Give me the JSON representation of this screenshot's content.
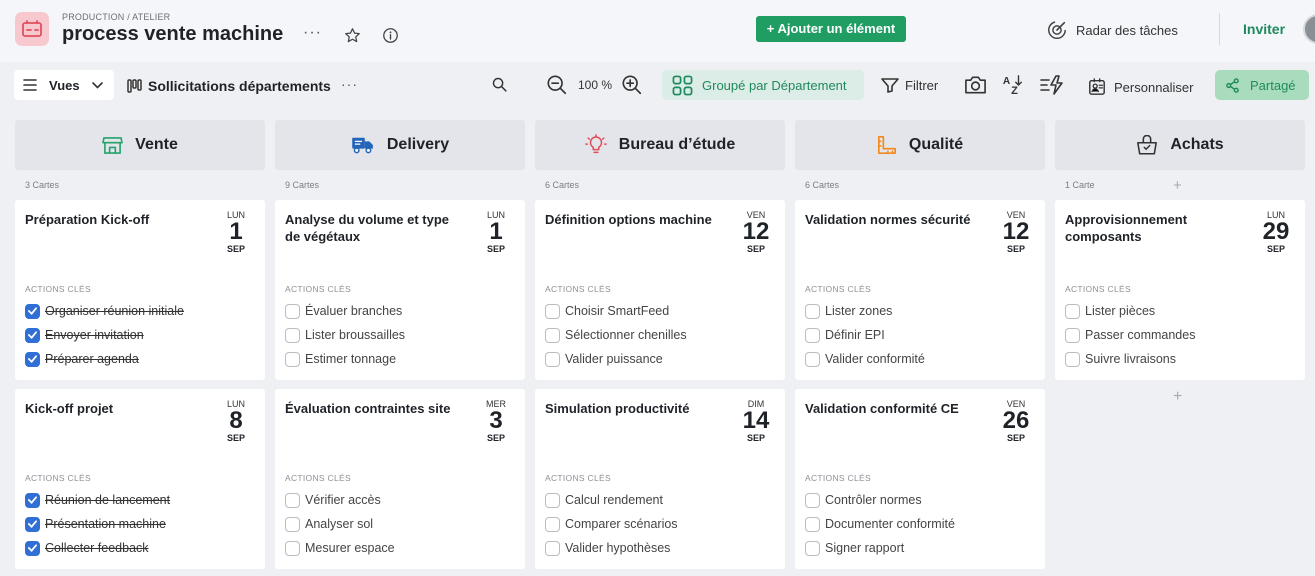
{
  "header": {
    "breadcrumb": "PRODUCTION / ATELIER",
    "title": "process vente machine",
    "more": "···",
    "add_button": "+ Ajouter un élément",
    "radar": "Radar des tâches",
    "invite": "Inviter"
  },
  "toolbar": {
    "views": "Vues",
    "view_name": "Sollicitations départements",
    "more": "···",
    "zoom": "100 %",
    "group": "Groupé par Département",
    "filter": "Filtrer",
    "customize": "Personnaliser",
    "share": "Partagé"
  },
  "labels": {
    "actions": "ACTIONS CLÉS"
  },
  "columns": [
    {
      "name": "Vente",
      "icon": "store-icon",
      "count": "3 Cartes",
      "cards": [
        {
          "title": "Préparation Kick-off",
          "dow": "LUN",
          "day": "1",
          "month": "SEP",
          "tasks": [
            {
              "label": "Organiser réunion initiale",
              "done": true
            },
            {
              "label": "Envoyer invitation",
              "done": true
            },
            {
              "label": "Préparer agenda",
              "done": true
            }
          ]
        },
        {
          "title": "Kick-off projet",
          "dow": "LUN",
          "day": "8",
          "month": "SEP",
          "tasks": [
            {
              "label": "Réunion de lancement",
              "done": true
            },
            {
              "label": "Présentation machine",
              "done": true
            },
            {
              "label": "Collecter feedback",
              "done": true
            }
          ]
        }
      ]
    },
    {
      "name": "Delivery",
      "icon": "truck-icon",
      "count": "9 Cartes",
      "cards": [
        {
          "title": "Analyse du volume et type de végétaux",
          "dow": "LUN",
          "day": "1",
          "month": "SEP",
          "tasks": [
            {
              "label": "Évaluer branches",
              "done": false
            },
            {
              "label": "Lister broussailles",
              "done": false
            },
            {
              "label": "Estimer tonnage",
              "done": false
            }
          ]
        },
        {
          "title": "Évaluation contraintes site",
          "dow": "MER",
          "day": "3",
          "month": "SEP",
          "tasks": [
            {
              "label": "Vérifier accès",
              "done": false
            },
            {
              "label": "Analyser sol",
              "done": false
            },
            {
              "label": "Mesurer espace",
              "done": false
            }
          ]
        }
      ]
    },
    {
      "name": "Bureau d’étude",
      "icon": "lightbulb-icon",
      "count": "6 Cartes",
      "cards": [
        {
          "title": "Définition options machine",
          "dow": "VEN",
          "day": "12",
          "month": "SEP",
          "tasks": [
            {
              "label": "Choisir SmartFeed",
              "done": false
            },
            {
              "label": "Sélectionner chenilles",
              "done": false
            },
            {
              "label": "Valider puissance",
              "done": false
            }
          ]
        },
        {
          "title": "Simulation productivité",
          "dow": "DIM",
          "day": "14",
          "month": "SEP",
          "tasks": [
            {
              "label": "Calcul rendement",
              "done": false
            },
            {
              "label": "Comparer scénarios",
              "done": false
            },
            {
              "label": "Valider hypothèses",
              "done": false
            }
          ]
        }
      ]
    },
    {
      "name": "Qualité",
      "icon": "ruler-icon",
      "count": "6 Cartes",
      "cards": [
        {
          "title": "Validation normes sécurité",
          "dow": "VEN",
          "day": "12",
          "month": "SEP",
          "tasks": [
            {
              "label": "Lister zones",
              "done": false
            },
            {
              "label": "Définir EPI",
              "done": false
            },
            {
              "label": "Valider conformité",
              "done": false
            }
          ]
        },
        {
          "title": "Validation conformité CE",
          "dow": "VEN",
          "day": "26",
          "month": "SEP",
          "tasks": [
            {
              "label": "Contrôler normes",
              "done": false
            },
            {
              "label": "Documenter conformité",
              "done": false
            },
            {
              "label": "Signer rapport",
              "done": false
            }
          ]
        }
      ]
    },
    {
      "name": "Achats",
      "icon": "shopping-basket-icon",
      "count": "1 Carte",
      "cards": [
        {
          "title": "Approvisionnement composants",
          "dow": "LUN",
          "day": "29",
          "month": "SEP",
          "tasks": [
            {
              "label": "Lister pièces",
              "done": false
            },
            {
              "label": "Passer commandes",
              "done": false
            },
            {
              "label": "Suivre livraisons",
              "done": false
            }
          ]
        }
      ]
    }
  ]
}
